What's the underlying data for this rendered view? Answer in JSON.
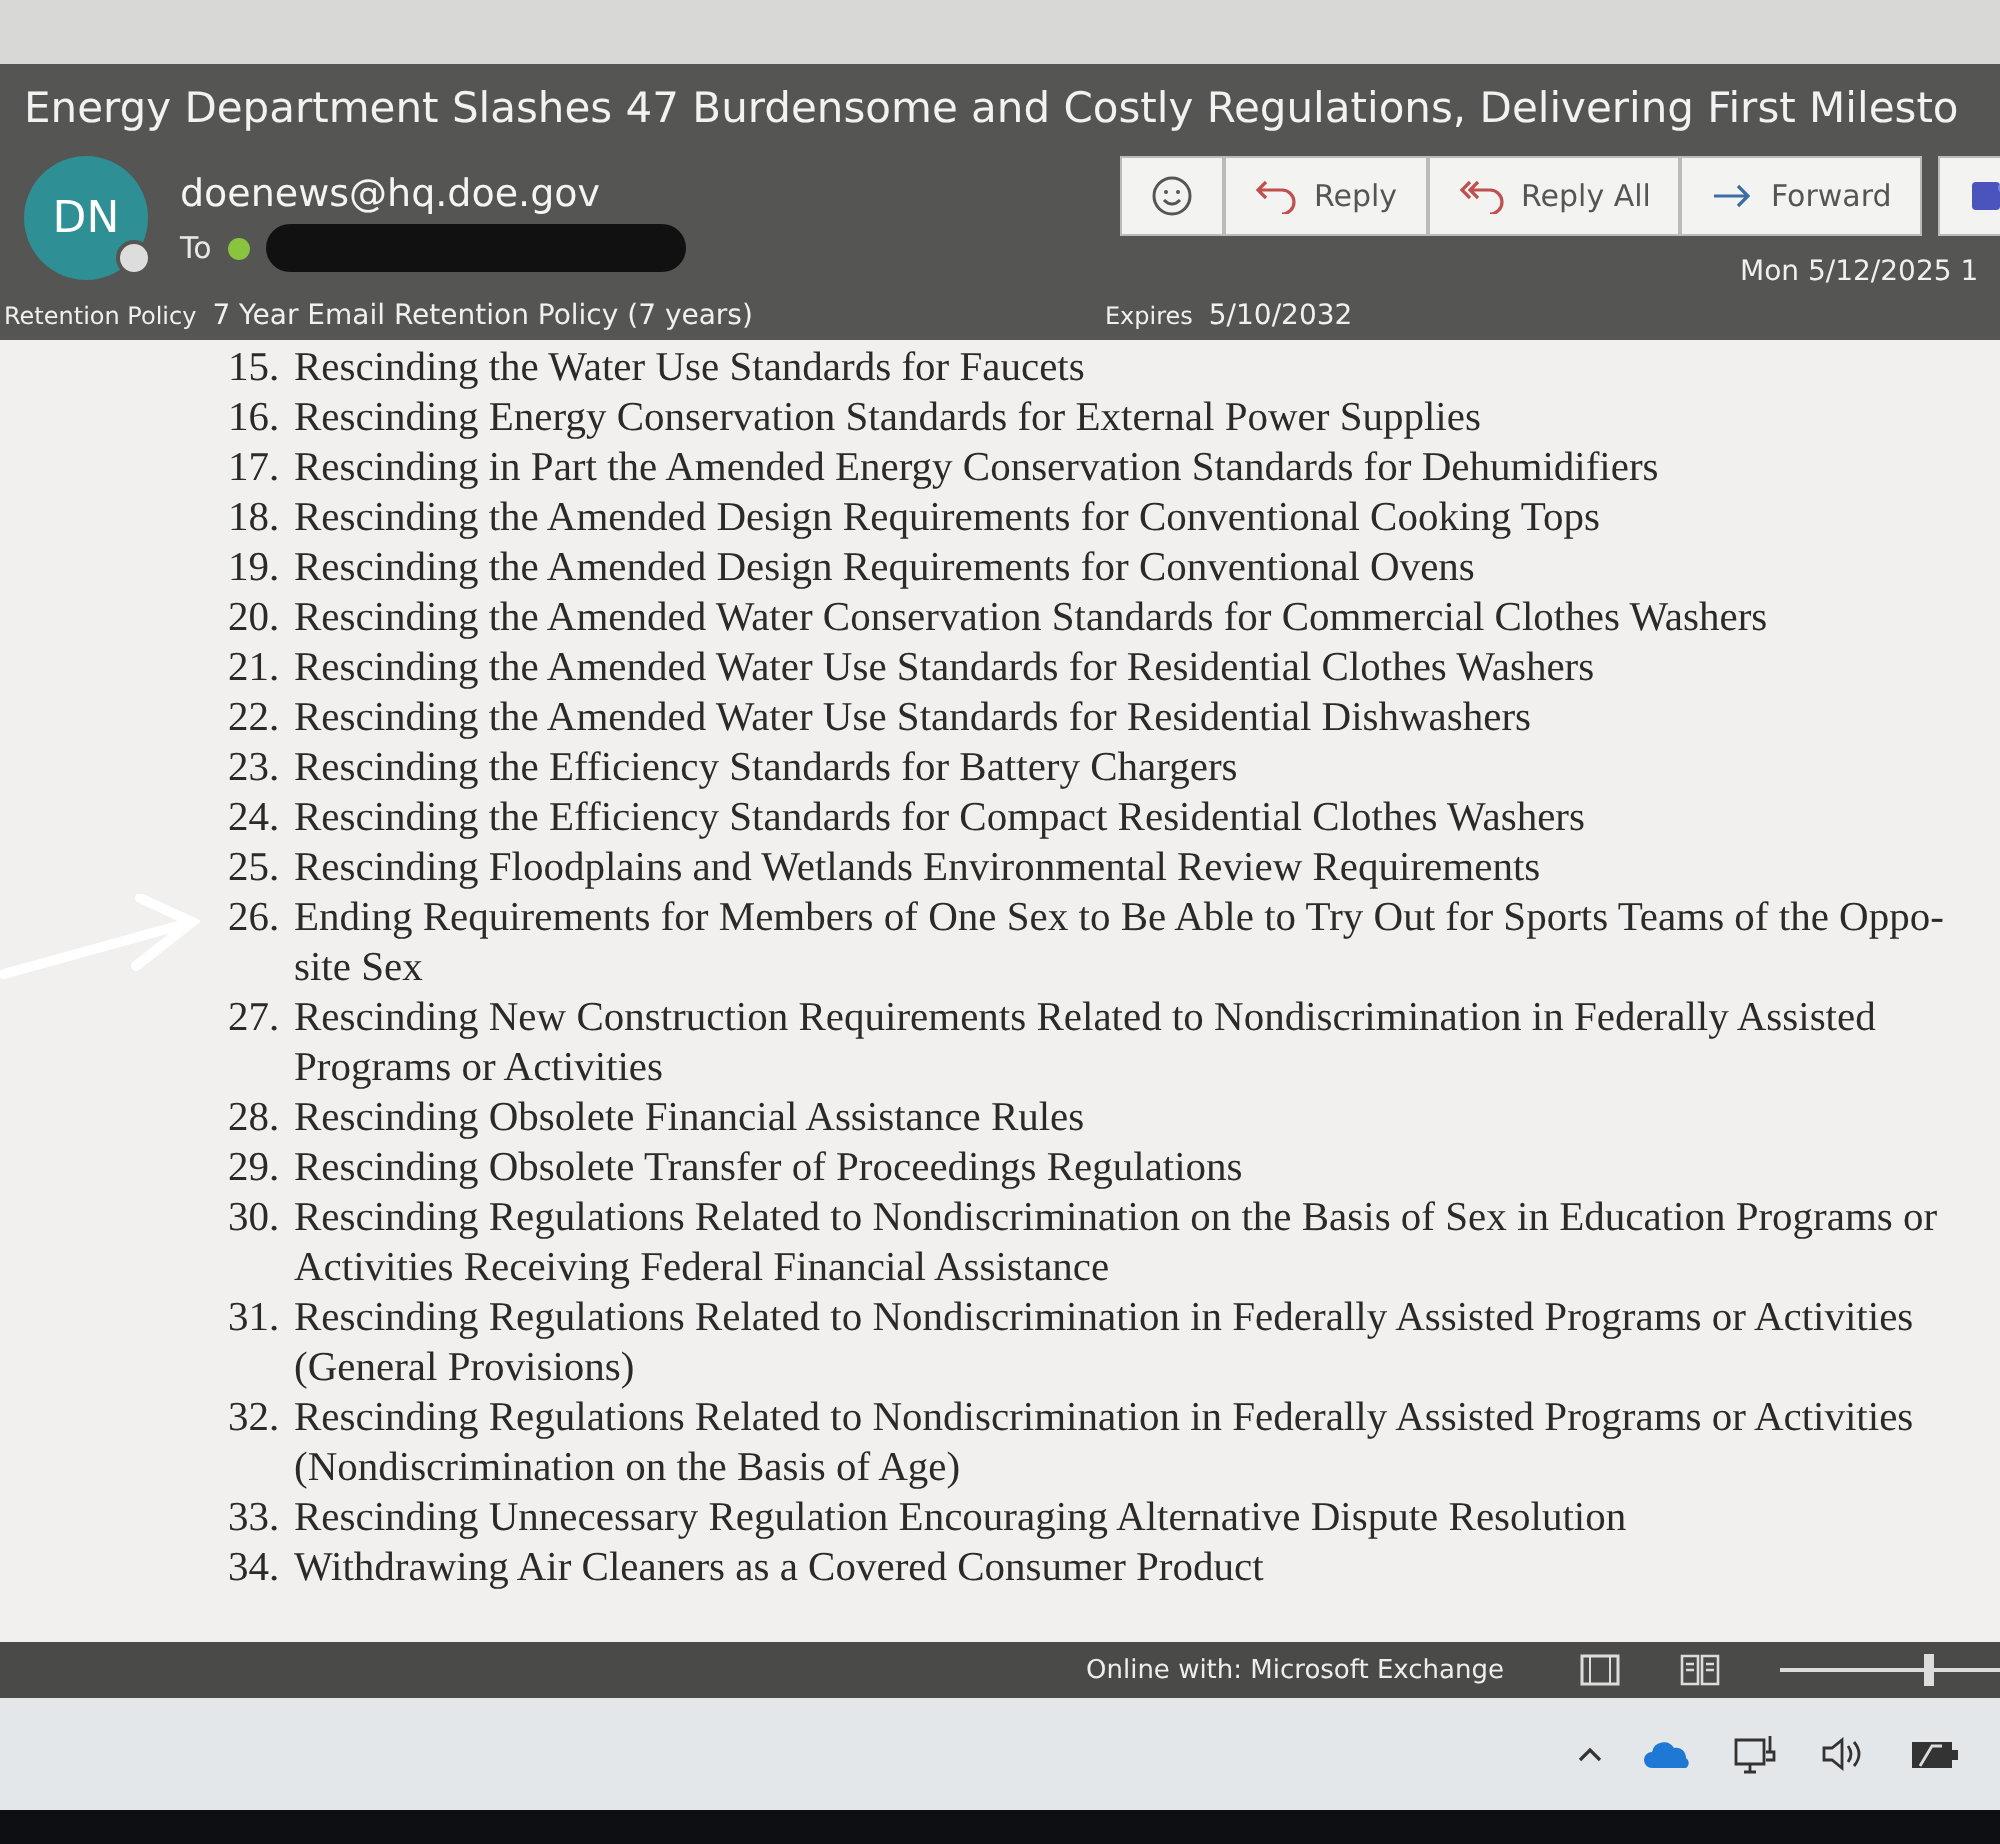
{
  "message": {
    "subject": "Energy Department Slashes 47 Burdensome and Costly Regulations, Delivering First Milesto",
    "avatar_initials": "DN",
    "sender": "doenews@hq.doe.gov",
    "to_label": "To",
    "recipient_redacted": true,
    "actions": [
      {
        "kind": "emoji"
      },
      {
        "kind": "reply",
        "label": "Reply"
      },
      {
        "kind": "replyall",
        "label": "Reply All"
      },
      {
        "kind": "forward",
        "label": "Forward"
      },
      {
        "kind": "teams"
      }
    ],
    "date": "Mon 5/12/2025 1",
    "retention_label": "Retention Policy",
    "retention_value": "7 Year Email Retention Policy (7 years)",
    "expires_label": "Expires",
    "expires_value": "5/10/2032"
  },
  "items": [
    {
      "number": "15.",
      "text": "Rescinding the Water Use Standards for Faucets",
      "marked": false
    },
    {
      "number": "16.",
      "text": "Rescinding Energy Conservation Standards for External Power Supplies",
      "marked": false
    },
    {
      "number": "17.",
      "text": "Rescinding in Part the Amended Energy Conservation Standards for Dehumidifiers",
      "marked": false
    },
    {
      "number": "18.",
      "text": "Rescinding the Amended Design Requirements for Conventional Cooking Tops",
      "marked": false
    },
    {
      "number": "19.",
      "text": "Rescinding the Amended Design Requirements for Conventional Ovens",
      "marked": false
    },
    {
      "number": "20.",
      "text": "Rescinding the Amended Water Conservation Standards for Commercial Clothes Washers",
      "marked": false
    },
    {
      "number": "21.",
      "text": "Rescinding the Amended Water Use Standards for Residential Clothes Washers",
      "marked": false
    },
    {
      "number": "22.",
      "text": "Rescinding the Amended Water Use Standards for Residential Dishwashers",
      "marked": false
    },
    {
      "number": "23.",
      "text": "Rescinding the Efficiency Standards for Battery Chargers",
      "marked": false
    },
    {
      "number": "24.",
      "text": "Rescinding the Efficiency Standards for Compact Residential Clothes Washers",
      "marked": false
    },
    {
      "number": "25.",
      "text": "Rescinding Floodplains and Wetlands Environmental Review Requirements",
      "marked": false
    },
    {
      "number": "26.",
      "text": "Ending Requirements for Members of One Sex to Be Able to Try Out for Sports Teams of the Oppo-site Sex",
      "marked": true
    },
    {
      "number": "27.",
      "text": "Rescinding New Construction Requirements Related to Nondiscrimination in Federally Assisted Programs or Activities",
      "marked": false
    },
    {
      "number": "28.",
      "text": "Rescinding Obsolete Financial Assistance Rules",
      "marked": false
    },
    {
      "number": "29.",
      "text": "Rescinding Obsolete Transfer of Proceedings Regulations",
      "marked": false
    },
    {
      "number": "30.",
      "text": "Rescinding Regulations Related to Nondiscrimination on the Basis of Sex in Education Programs or Activities Receiving Federal Financial Assistance",
      "marked": false
    },
    {
      "number": "31.",
      "text": "Rescinding Regulations Related to Nondiscrimination in Federally Assisted Programs or Activities (General Provisions)",
      "marked": false
    },
    {
      "number": "32.",
      "text": "Rescinding Regulations Related to Nondiscrimination in Federally Assisted Programs or Activities (Nondiscrimination on the Basis of Age)",
      "marked": false
    },
    {
      "number": "33.",
      "text": "Rescinding Unnecessary Regulation Encouraging Alternative Dispute Resolution",
      "marked": false
    },
    {
      "number": "34.",
      "text": "Withdrawing Air Cleaners as a Covered Consumer Product",
      "marked": false
    }
  ],
  "status_bar": {
    "text": "Online with: Microsoft Exchange",
    "zoom": {
      "level": 0.7
    }
  }
}
